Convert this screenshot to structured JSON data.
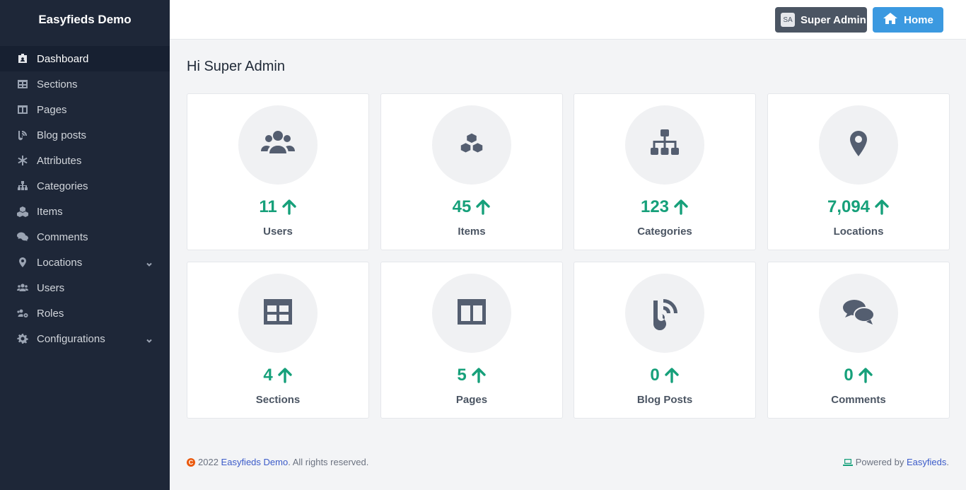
{
  "app": {
    "brand": "Easyfieds Demo"
  },
  "sidebar": {
    "items": [
      {
        "label": "Dashboard",
        "icon": "id-card-icon",
        "active": true
      },
      {
        "label": "Sections",
        "icon": "table-icon"
      },
      {
        "label": "Pages",
        "icon": "columns-icon"
      },
      {
        "label": "Blog posts",
        "icon": "blog-icon"
      },
      {
        "label": "Attributes",
        "icon": "asterisk-icon"
      },
      {
        "label": "Categories",
        "icon": "sitemap-icon"
      },
      {
        "label": "Items",
        "icon": "cubes-icon"
      },
      {
        "label": "Comments",
        "icon": "comments-icon"
      },
      {
        "label": "Locations",
        "icon": "map-marker-icon",
        "has_submenu": true
      },
      {
        "label": "Users",
        "icon": "users-icon"
      },
      {
        "label": "Roles",
        "icon": "users-cog-icon"
      },
      {
        "label": "Configurations",
        "icon": "cog-icon",
        "has_submenu": true
      }
    ]
  },
  "header": {
    "user_initials": "SA",
    "user_label": "Super Admin",
    "home_label": "Home"
  },
  "main": {
    "greeting": "Hi Super Admin",
    "stats": [
      {
        "value": "11",
        "label": "Users",
        "icon": "users-icon"
      },
      {
        "value": "45",
        "label": "Items",
        "icon": "cubes-icon"
      },
      {
        "value": "123",
        "label": "Categories",
        "icon": "sitemap-icon"
      },
      {
        "value": "7,094",
        "label": "Locations",
        "icon": "map-marker-icon"
      },
      {
        "value": "4",
        "label": "Sections",
        "icon": "table-icon"
      },
      {
        "value": "5",
        "label": "Pages",
        "icon": "columns-icon"
      },
      {
        "value": "0",
        "label": "Blog Posts",
        "icon": "blog-icon"
      },
      {
        "value": "0",
        "label": "Comments",
        "icon": "comments-icon"
      }
    ]
  },
  "footer": {
    "copyright_prefix": "2022",
    "copyright_link": "Easyfieds Demo",
    "copyright_suffix": ". All rights reserved.",
    "powered_prefix": "Powered by",
    "powered_link": "Easyfieds",
    "powered_suffix": "."
  },
  "colors": {
    "sidebar_bg": "#1e2738",
    "accent_green": "#16a07a",
    "home_button": "#3b99e0",
    "admin_button": "#4b5563"
  }
}
